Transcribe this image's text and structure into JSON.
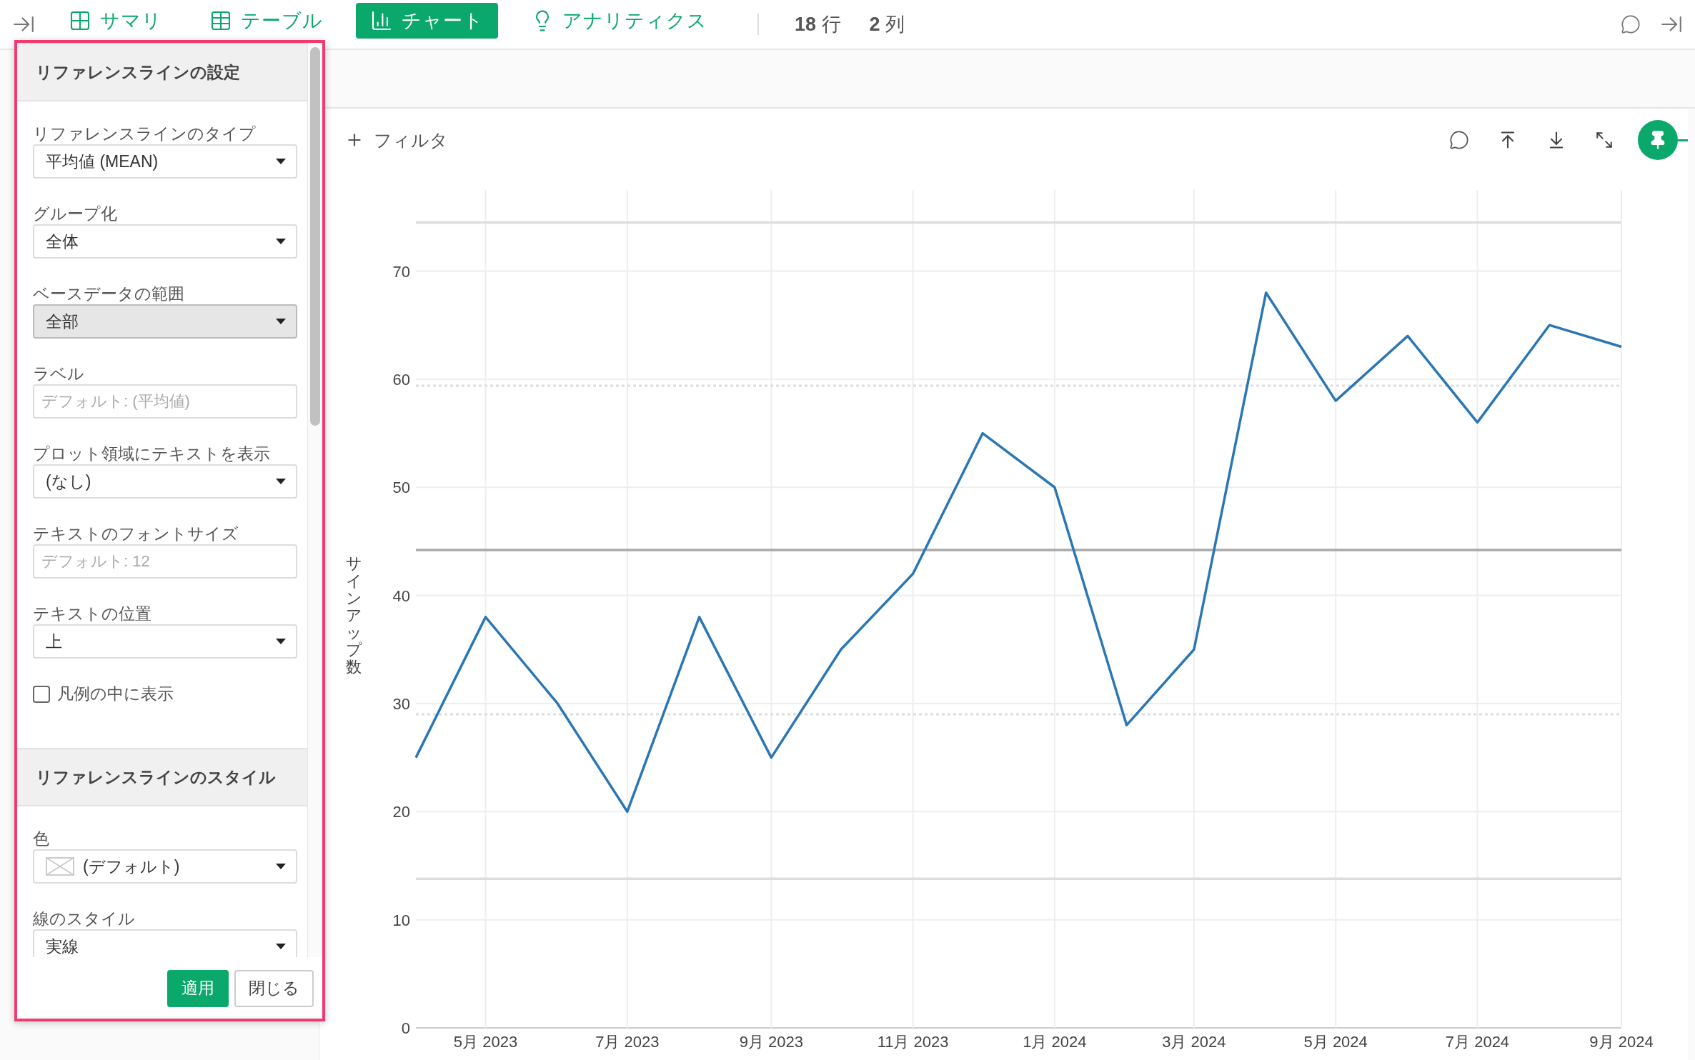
{
  "toolbar": {
    "tabs": [
      {
        "label": "サマリ",
        "kind": "summary",
        "selected": false
      },
      {
        "label": "テーブル",
        "kind": "table",
        "selected": false
      },
      {
        "label": "チャート",
        "kind": "chart",
        "selected": true
      },
      {
        "label": "アナリティクス",
        "kind": "analytics",
        "selected": false
      }
    ],
    "rows": "**18** 行",
    "columns": "**2** 列"
  },
  "reference_panel": {
    "sections": [
      {
        "title": "リファレンスラインの設定",
        "fields": [
          {
            "kind": "select",
            "label": "リファレンスラインのタイプ",
            "value": "平均値 (MEAN)",
            "active": false
          },
          {
            "kind": "select",
            "label": "グループ化",
            "value": "全体",
            "active": false
          },
          {
            "kind": "select",
            "label": "ベースデータの範囲",
            "value": "全部",
            "active": true
          },
          {
            "kind": "input",
            "label": "ラベル",
            "placeholder": "デフォルト: (平均値)"
          },
          {
            "kind": "select",
            "label": "プロット領域にテキストを表示",
            "value": "(なし)",
            "active": false
          },
          {
            "kind": "input",
            "label": "テキストのフォントサイズ",
            "placeholder": "デフォルト: 12"
          },
          {
            "kind": "select",
            "label": "テキストの位置",
            "value": "上",
            "active": false
          },
          {
            "kind": "checkbox",
            "label": "凡例の中に表示",
            "checked": false
          }
        ]
      },
      {
        "title": "リファレンスラインのスタイル",
        "fields": [
          {
            "kind": "color_select",
            "label": "色",
            "value": "(デフォルト)",
            "active": false
          },
          {
            "kind": "select",
            "label": "線のスタイル",
            "value": "実線",
            "active": false
          }
        ]
      }
    ],
    "buttons": [
      {
        "label": "適用",
        "kind": "primary"
      },
      {
        "label": "閉じる",
        "kind": "secondary"
      }
    ]
  },
  "chart_panel": {
    "filter": "フィルタ",
    "chart_data": {
      "type": "line",
      "ylabel": "サインアップ数",
      "x": [
        "2023-04",
        "2023-05",
        "2023-06",
        "2023-07",
        "2023-08",
        "2023-09",
        "2023-10",
        "2023-11",
        "2023-12",
        "2024-01",
        "2024-02",
        "2024-03",
        "2024-04",
        "2024-05",
        "2024-06",
        "2024-07",
        "2024-08",
        "2024-09"
      ],
      "xlim": [
        "2023-04",
        "2024-09"
      ],
      "series": [
        {
          "color": "#2a77b4",
          "values": [
            25,
            38,
            30,
            20,
            38,
            25,
            35,
            42,
            55,
            50,
            28,
            35,
            68,
            58,
            64,
            56,
            65,
            63
          ]
        }
      ],
      "ylim": [
        0,
        77.5
      ],
      "yticks": [
        0,
        10,
        20,
        30,
        40,
        50,
        60,
        70
      ],
      "xticks": [
        {
          "value": "2023-05",
          "label": "5月 2023"
        },
        {
          "value": "2023-07",
          "label": "7月 2023"
        },
        {
          "value": "2023-09",
          "label": "9月 2023"
        },
        {
          "value": "2023-11",
          "label": "11月 2023"
        },
        {
          "value": "2024-01",
          "label": "1月 2024"
        },
        {
          "value": "2024-03",
          "label": "3月 2024"
        },
        {
          "value": "2024-05",
          "label": "5月 2024"
        },
        {
          "value": "2024-07",
          "label": "7月 2024"
        },
        {
          "value": "2024-09",
          "label": "9月 2024"
        }
      ],
      "grid": true,
      "ref_lines": [
        {
          "axis": "y",
          "value": 74.5
        },
        {
          "axis": "y",
          "value": 59.4
        },
        {
          "axis": "y",
          "value": 44.2
        },
        {
          "axis": "y",
          "value": 29
        },
        {
          "axis": "y",
          "value": 13.8
        }
      ]
    }
  }
}
